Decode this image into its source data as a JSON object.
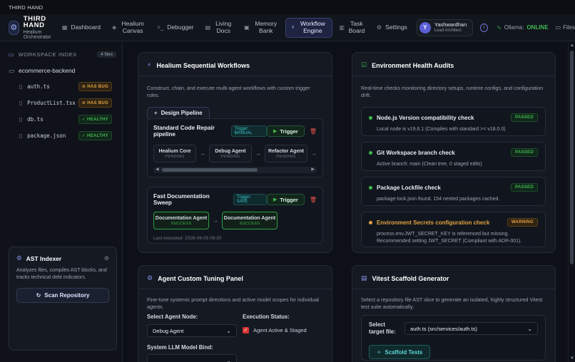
{
  "window": {
    "title": "THIRD HAND"
  },
  "brand": {
    "title": "THIRD HAND",
    "subtitle": "Healium Orchestrator"
  },
  "nav": {
    "dashboard": "Dashboard",
    "canvas": "Healium Canvas",
    "debugger": "Debugger",
    "docs": "Living Docs",
    "memory": "Memory Bank",
    "workflow": "Workflow Engine",
    "taskboard": "Task Board",
    "settings": "Settings"
  },
  "user": {
    "initial": "Y",
    "name": "Yashwardhan",
    "role": "Lead Architect"
  },
  "status": {
    "label": "Ollama:",
    "value": "ONLINE",
    "files": "Files"
  },
  "sidebar": {
    "header": "WORKSPACE INDEX",
    "count": "4 files",
    "repo": "ecommerce-backend",
    "files": [
      {
        "name": "auth.ts",
        "badge": "HAS BUG"
      },
      {
        "name": "ProductList.tsx",
        "badge": "HAS BUG"
      },
      {
        "name": "db.ts",
        "badge": "HEALTHY"
      },
      {
        "name": "package.json",
        "badge": "HEALTHY"
      }
    ]
  },
  "ast": {
    "title": "AST Indexer",
    "desc": "Analyzes files, compiles AST blocks, and tracks technical debt indicators.",
    "button": "Scan Repository"
  },
  "workflows": {
    "title": "Healium Sequential Workflows",
    "desc": "Construct, chain, and execute multi-agent workflows with custom trigger rules.",
    "design_btn": "Design Pipeline",
    "trigger_label": "Trigger",
    "items": [
      {
        "name": "Standard Code Repair pipeline",
        "trigger": "Trigger: MANUAL",
        "nodes": [
          {
            "name": "Healium Core",
            "state": "PENDING"
          },
          {
            "name": "Debug Agent",
            "state": "PENDING"
          },
          {
            "name": "Refactor Agent",
            "state": "PENDING"
          }
        ]
      },
      {
        "name": "Fast Documentation Sweep",
        "trigger": "Trigger: SAVE",
        "nodes": [
          {
            "name": "Documentation Agent",
            "state": "SUCCESS"
          },
          {
            "name": "Documentation Agent",
            "state": "SUCCESS"
          }
        ],
        "last_executed": "Last executed: 2026-06-05 08:30"
      }
    ]
  },
  "health": {
    "title": "Environment Health Audits",
    "desc": "Real-time checks monitoring directory setups, runtime configs, and configuration drift.",
    "checks": [
      {
        "title": "Node.js Version compatibility check",
        "status": "PASSED",
        "detail": "Local node is v19.8.1 (Complies with standard >= v18.0.0)"
      },
      {
        "title": "Git Workspace branch check",
        "status": "PASSED",
        "detail": "Active branch: main (Clean tree, 0 staged edits)"
      },
      {
        "title": "Package Lockfile check",
        "status": "PASSED",
        "detail": "package-lock.json found. 154 nested packages cached."
      },
      {
        "title": "Environment Secrets configuration check",
        "status": "WARNING",
        "detail": "process.env.JWT_SECRET_KEY is referenced but missing. Recommended setting JWT_SECRET (Compliant with ADR-001)."
      }
    ]
  },
  "tuning": {
    "title": "Agent Custom Tuning Panel",
    "desc": "Fine-tune systemic prompt directions and active model scopes for individual agents.",
    "agent_label": "Select Agent Node:",
    "agent_value": "Debug Agent",
    "exec_label": "Execution Status:",
    "exec_value": "Agent Active & Staged",
    "model_label": "System LLM Model Bind:"
  },
  "vitest": {
    "title": "Vitest Scaffold Generator",
    "desc": "Select a repository file AST slice to generate an isolated, highly structured Vitest test suite automatically.",
    "file_label": "Select target file:",
    "file_value": "auth.ts (src/services/auth.ts)",
    "button": "Scaffold Tests"
  }
}
